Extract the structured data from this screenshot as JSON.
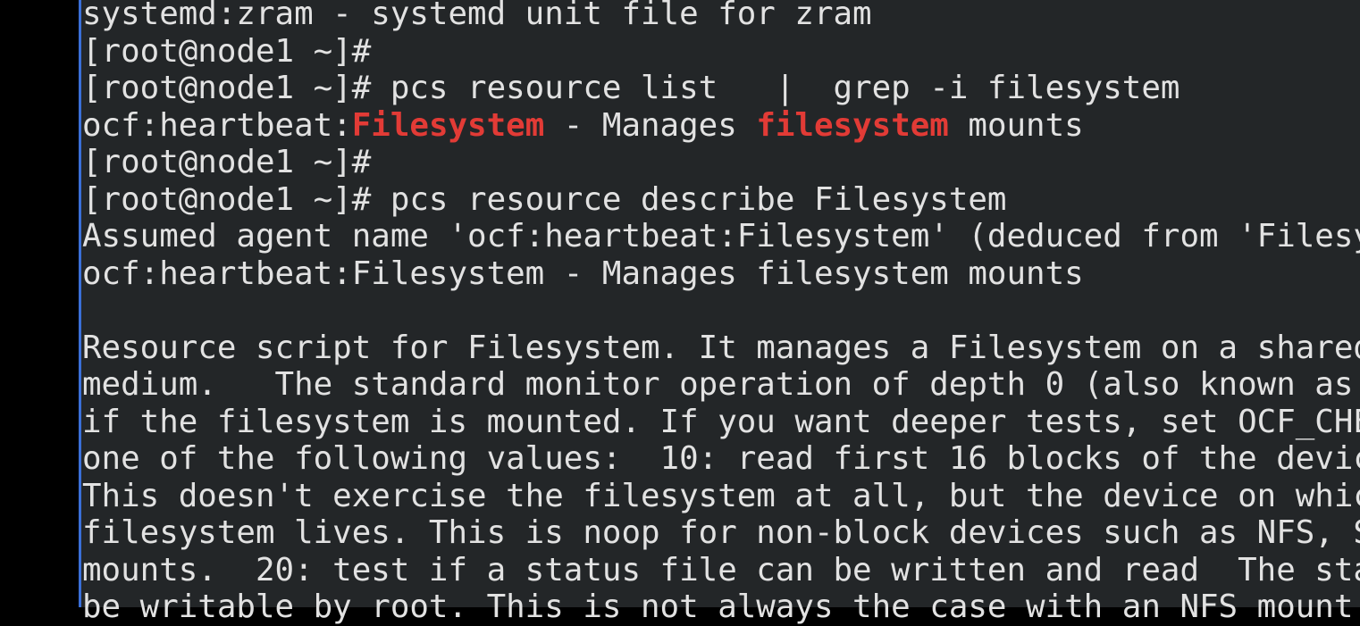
{
  "terminal": {
    "lines": [
      "systemd:zram - systemd unit file for zram",
      "[root@node1 ~]#",
      "[root@node1 ~]# pcs resource list   |  grep -i filesystem",
      null,
      "[root@node1 ~]#",
      "[root@node1 ~]# pcs resource describe Filesystem",
      "Assumed agent name 'ocf:heartbeat:Filesystem' (deduced from 'Filesy",
      "ocf:heartbeat:Filesystem - Manages filesystem mounts",
      "",
      "Resource script for Filesystem. It manages a Filesystem on a shared",
      "medium.   The standard monitor operation of depth 0 (also known as",
      "if the filesystem is mounted. If you want deeper tests, set OCF_CHE",
      "one of the following values:  10: read first 16 blocks of the devic",
      "This doesn't exercise the filesystem at all, but the device on whic",
      "filesystem lives. This is noop for non-block devices such as NFS, S",
      "mounts.  20: test if a status file can be written and read  The sta",
      "be writable by root. This is not always the case with an NFS mount"
    ],
    "grep_line": {
      "prefix": "ocf:heartbeat:",
      "match1": "Filesystem",
      "middle": " - Manages ",
      "match2": "filesystem",
      "suffix": " mounts"
    }
  },
  "colors": {
    "background": "#232628",
    "text": "#e2e2e2",
    "match": "#e23b36"
  }
}
